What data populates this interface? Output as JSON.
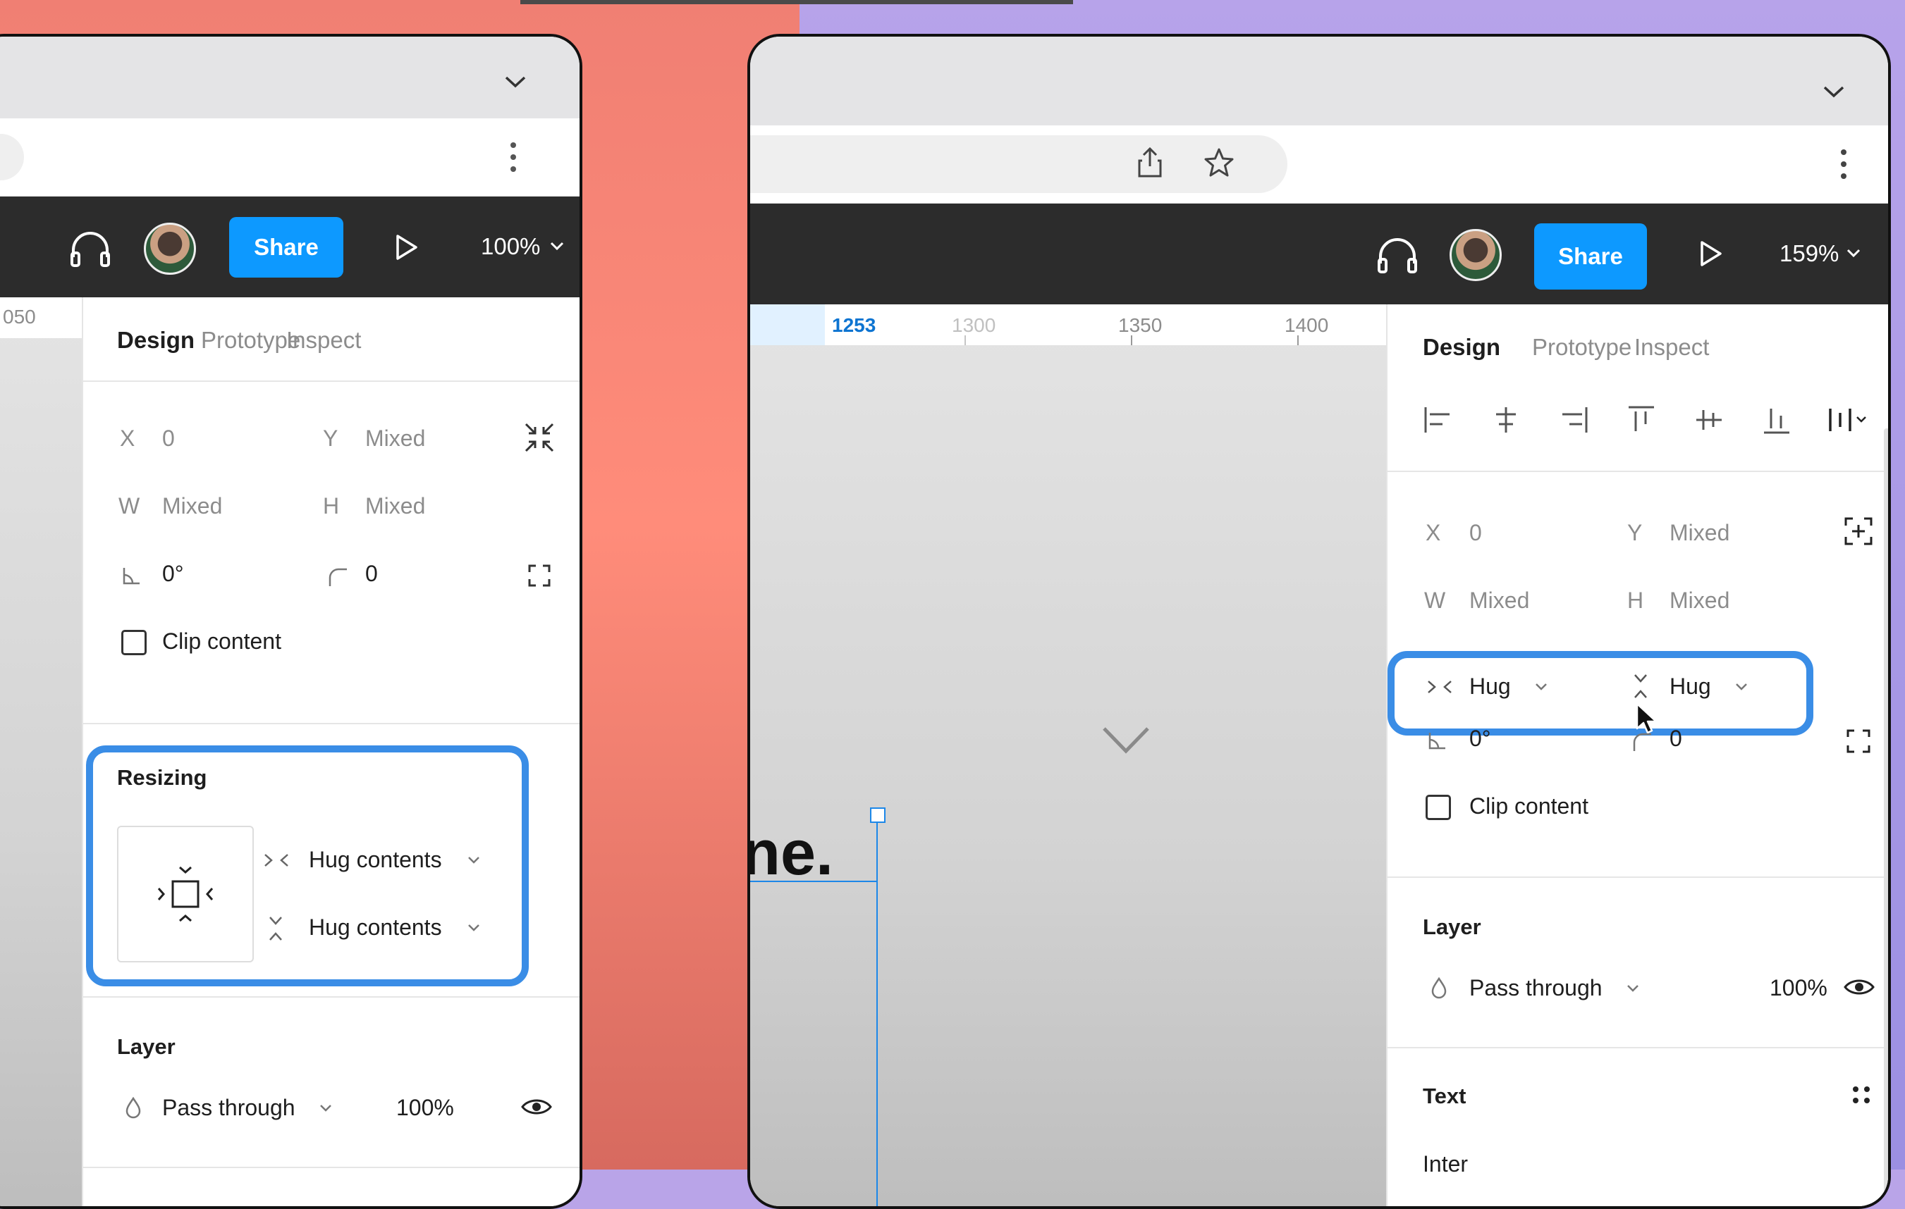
{
  "left": {
    "toolbar": {
      "share_label": "Share",
      "zoom": "100%"
    },
    "ruler": {
      "tick": "050"
    },
    "tabs": [
      "Design",
      "Prototype",
      "Inspect"
    ],
    "props": {
      "x_label": "X",
      "x_value": "0",
      "y_label": "Y",
      "y_value": "Mixed",
      "w_label": "W",
      "w_value": "Mixed",
      "h_label": "H",
      "h_value": "Mixed",
      "rotation": "0°",
      "radius": "0",
      "clip": "Clip content"
    },
    "resizing": {
      "title": "Resizing",
      "horizontal": "Hug contents",
      "vertical": "Hug contents"
    },
    "layer": {
      "title": "Layer",
      "blend": "Pass through",
      "opacity": "100%"
    }
  },
  "right": {
    "toolbar": {
      "share_label": "Share",
      "zoom": "159%"
    },
    "ruler": {
      "ticks": [
        "1253",
        "1300",
        "1350",
        "1400"
      ]
    },
    "canvas_text": "ne.",
    "tabs": [
      "Design",
      "Prototype",
      "Inspect"
    ],
    "props": {
      "x_label": "X",
      "x_value": "0",
      "y_label": "Y",
      "y_value": "Mixed",
      "w_label": "W",
      "w_value": "Mixed",
      "h_label": "H",
      "h_value": "Mixed",
      "hug_h": "Hug",
      "hug_v": "Hug",
      "rotation": "0°",
      "radius": "0",
      "clip": "Clip content"
    },
    "layer": {
      "title": "Layer",
      "blend": "Pass through",
      "opacity": "100%"
    },
    "text": {
      "title": "Text",
      "font": "Inter"
    }
  },
  "colors": {
    "accent": "#0d99ff",
    "highlight": "#3a8de6",
    "toolbar": "#2c2c2c"
  }
}
